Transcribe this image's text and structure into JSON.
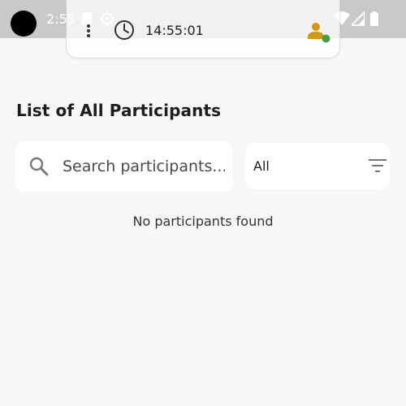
{
  "status_bar": {
    "time": "2:55",
    "icons": [
      "sim-card-icon",
      "gear-icon",
      "wifi-icon",
      "signal-icon",
      "battery-icon"
    ]
  },
  "timer_chip": {
    "time": "14:55:01",
    "icons": [
      "more-vert-icon",
      "clock-icon",
      "user-online-icon"
    ],
    "user_status_color": "#43a047",
    "user_icon_color": "#d4950f"
  },
  "main": {
    "title": "List of All Participants",
    "search": {
      "placeholder": "Search participants...",
      "value": ""
    },
    "filter": {
      "selected": "All"
    },
    "empty_message": "No participants found"
  }
}
